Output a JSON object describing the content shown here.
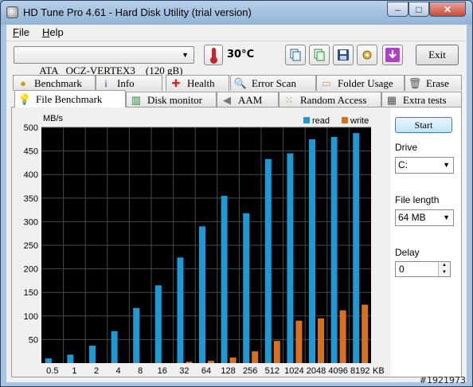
{
  "window": {
    "title": "HD Tune Pro 4.61 - Hard Disk Utility (trial version)",
    "min": "–",
    "max": "□",
    "close": "✕"
  },
  "menu": {
    "file": "File",
    "help": "Help"
  },
  "toolbar": {
    "drive": "ATA   OCZ-VERTEX3    (120 gB)",
    "temperature": "30°C",
    "exit_label": "Exit",
    "icons": [
      "copy-icon",
      "copy-info-icon",
      "save-icon",
      "options-icon",
      "download-icon"
    ]
  },
  "tabs_row1": [
    {
      "label": "Benchmark",
      "icon": "benchmark-icon"
    },
    {
      "label": "Info",
      "icon": "info-icon"
    },
    {
      "label": "Health",
      "icon": "health-icon"
    },
    {
      "label": "Error Scan",
      "icon": "error-scan-icon"
    },
    {
      "label": "Folder Usage",
      "icon": "folder-icon"
    },
    {
      "label": "Erase",
      "icon": "erase-icon"
    }
  ],
  "tabs_row2": [
    {
      "label": "File Benchmark",
      "icon": "file-benchmark-icon",
      "active": true
    },
    {
      "label": "Disk monitor",
      "icon": "disk-monitor-icon"
    },
    {
      "label": "AAM",
      "icon": "speaker-icon"
    },
    {
      "label": "Random Access",
      "icon": "random-access-icon"
    },
    {
      "label": "Extra tests",
      "icon": "extra-tests-icon"
    }
  ],
  "side_panel": {
    "start_label": "Start",
    "drive_label": "Drive",
    "drive_value": "C:",
    "file_length_label": "File length",
    "file_length_value": "64 MB",
    "delay_label": "Delay",
    "delay_value": "0"
  },
  "colors": {
    "read": "#1a9ad6",
    "write": "#d9711c",
    "plot_bg": "#000000",
    "grid": "#4a4a4a"
  },
  "chart_data": {
    "type": "bar",
    "ylabel": "MB/s",
    "xunit": "KB",
    "ylim": [
      0,
      500
    ],
    "yticks": [
      50,
      100,
      150,
      200,
      250,
      300,
      350,
      400,
      450,
      500
    ],
    "categories": [
      "0.5",
      "1",
      "2",
      "4",
      "8",
      "16",
      "32",
      "64",
      "128",
      "256",
      "512",
      "1024",
      "2048",
      "4096",
      "8192"
    ],
    "legend_position": "top-right",
    "series": [
      {
        "name": "read",
        "values": [
          10,
          18,
          37,
          68,
          117,
          165,
          224,
          290,
          355,
          318,
          433,
          445,
          475,
          480,
          488
        ]
      },
      {
        "name": "write",
        "values": [
          0,
          0,
          0,
          0,
          0,
          0,
          3,
          5,
          12,
          25,
          47,
          90,
          95,
          112,
          124
        ]
      }
    ]
  },
  "watermark": "#1921973"
}
